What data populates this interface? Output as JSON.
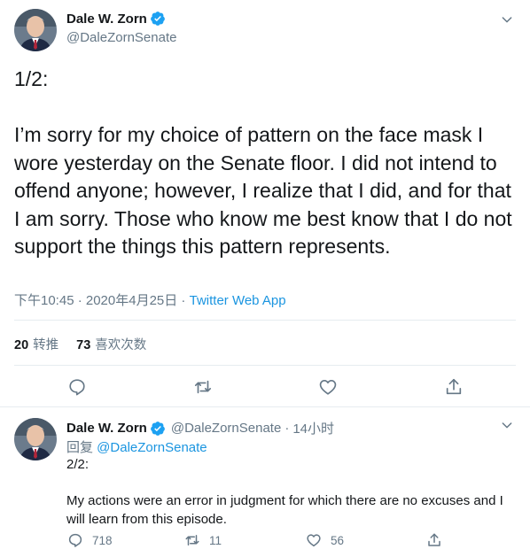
{
  "colors": {
    "verified": "#1da1f2",
    "link": "#1b95e0",
    "secondary": "#657786",
    "text": "#14171a"
  },
  "main_tweet": {
    "display_name": "Dale W. Zorn",
    "handle": "@DaleZornSenate",
    "text": "1/2:\n\nI’m sorry for my choice of pattern on the face mask I wore yesterday on the Senate floor. I did not intend to offend anyone; however, I realize that I did, and for that I am sorry. Those who know me best know that I do not support the things this pattern represents.",
    "timestamp": "下午10:45 · 2020年4月25日",
    "separator": " · ",
    "source": "Twitter Web App",
    "retweets_count": "20",
    "retweets_label": "转推",
    "likes_count": "73",
    "likes_label": "喜欢次数",
    "icons": {
      "reply": "reply-icon",
      "retweet": "retweet-icon",
      "like": "heart-icon",
      "share": "share-icon",
      "caret": "chevron-down-icon",
      "verified": "verified-badge-icon"
    }
  },
  "reply_tweet": {
    "display_name": "Dale W. Zorn",
    "handle": "@DaleZornSenate",
    "dot": "·",
    "time": "14小时",
    "reply_prefix": "回复 ",
    "reply_mention": "@DaleZornSenate",
    "text": "2/2:\n\nMy actions were an error in judgment for which there are no excuses and I will learn from this episode.",
    "reply_count": "718",
    "retweet_count": "11",
    "like_count": "56"
  }
}
